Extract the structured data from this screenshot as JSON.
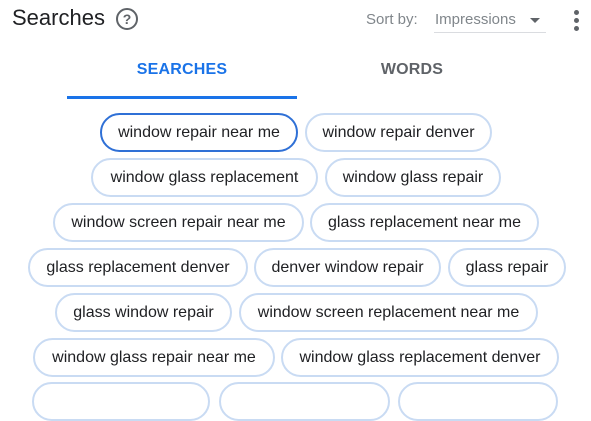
{
  "header": {
    "title": "Searches",
    "help_icon": "help-circle-icon",
    "help_glyph": "?",
    "sort_label": "Sort by:",
    "sort_value": "Impressions"
  },
  "tabs": [
    {
      "label": "SEARCHES",
      "active": true
    },
    {
      "label": "WORDS",
      "active": false
    }
  ],
  "chips": [
    "window repair near me",
    "window repair denver",
    "window glass replacement",
    "window glass repair",
    "window screen repair near me",
    "glass replacement near me",
    "glass replacement denver",
    "denver window repair",
    "glass repair",
    "glass window repair",
    "window screen replacement near me",
    "window glass repair near me",
    "window glass replacement denver"
  ],
  "colors": {
    "accent": "#1a73e8",
    "chip_border": "#c9dbf3",
    "chip_active_border": "#2f70d6"
  }
}
